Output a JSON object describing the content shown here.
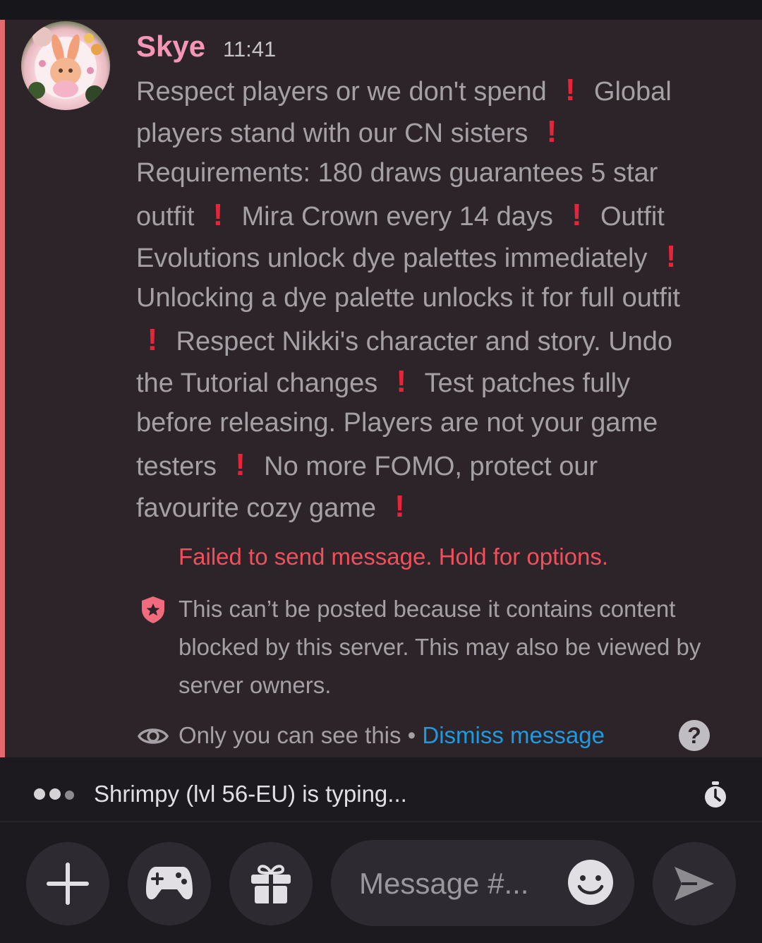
{
  "message": {
    "username": "Skye",
    "timestamp": "11:41",
    "lines": [
      [
        "Respect players or we don't spend ",
        "!",
        " Global"
      ],
      [
        "players stand with our CN sisters ",
        "!"
      ],
      [
        "Requirements: 180 draws guarantees 5 star"
      ],
      [
        "outfit ",
        "!",
        " Mira Crown every 14 days ",
        "!",
        " Outfit"
      ],
      [
        "Evolutions unlock dye palettes immediately ",
        "!"
      ],
      [
        "Unlocking a dye palette unlocks it for full outfit"
      ],
      [
        "!",
        " Respect Nikki's character and story. Undo"
      ],
      [
        "the Tutorial changes ",
        "!",
        " Test patches fully"
      ],
      [
        "before releasing. Players are not your game"
      ],
      [
        "testers ",
        "!",
        " No more FOMO, protect our"
      ],
      [
        "favourite cozy game ",
        "!"
      ]
    ],
    "failed_notice": "Failed to send message. Hold for options.",
    "blocked_notice": "This can’t be posted because it contains content blocked by this server. This may also be viewed by server owners.",
    "only_you": "Only you can see this • ",
    "dismiss_label": "Dismiss message",
    "help_glyph": "?"
  },
  "typing": {
    "text": "Shrimpy (lvl 56-EU) is typing..."
  },
  "composer": {
    "placeholder": "Message #..."
  },
  "icons": {
    "plus": "plus-icon",
    "game": "gamepad-icon",
    "gift": "gift-icon",
    "emoji": "emoji-icon",
    "send": "send-icon",
    "automod": "shield-star-icon",
    "eye": "eye-icon",
    "help": "help-icon",
    "timer": "stopwatch-icon"
  },
  "colors": {
    "username": "#f596b6",
    "alert": "#e4253a",
    "failed": "#f04f5b",
    "link": "#1f9ae0",
    "mention_bar": "#e26a6e"
  }
}
